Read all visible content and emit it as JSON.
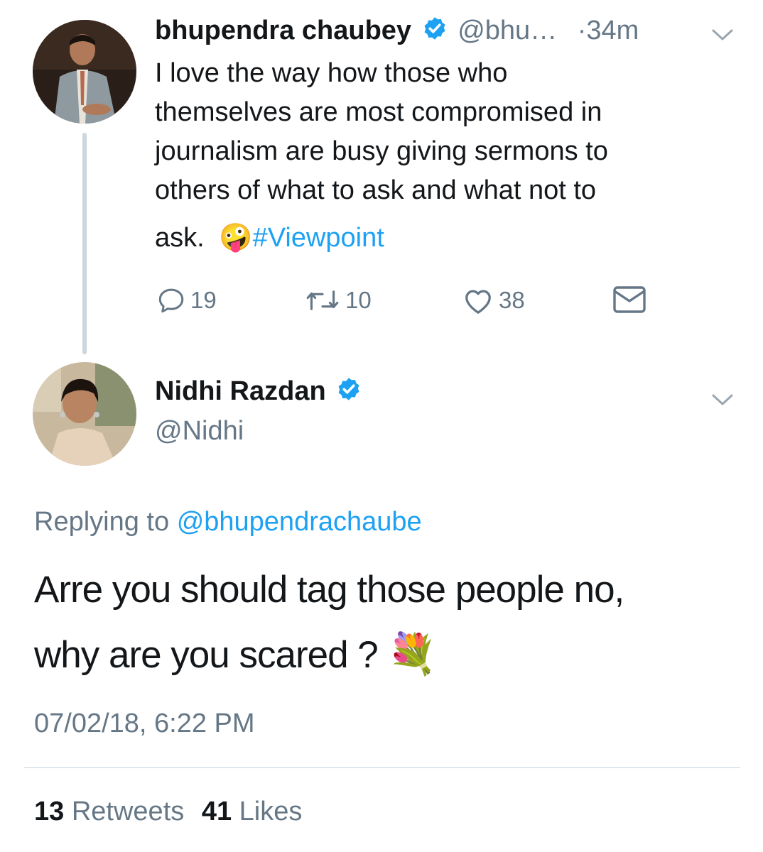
{
  "parent_tweet": {
    "author_name": "bhupendra chaubey",
    "handle": "@bhu…",
    "time": "·34m",
    "text_line1": "I love the way how those who",
    "text_line2": "themselves are most compromised in",
    "text_line3": "journalism are busy giving sermons to",
    "text_line4": "others of what to ask and what not to",
    "text_line5": "ask.",
    "hashtag": "#Viewpoint",
    "emoji": "🤪",
    "replies": "19",
    "retweets": "10",
    "likes": "38"
  },
  "main_tweet": {
    "author_name": "Nidhi Razdan",
    "handle": "@Nidhi",
    "replying_to_label": "Replying to",
    "replying_to_handle": "@bhupendrachaube",
    "text_line1": "Arre you should tag those people no,",
    "text_line2": "why are you scared ?",
    "emoji": "💐",
    "timestamp": "07/02/18, 6:22 PM",
    "retweet_count": "13",
    "retweet_label": "Retweets",
    "like_count": "41",
    "like_label": "Likes"
  },
  "colors": {
    "accent": "#1da1f2",
    "secondary_text": "#657786",
    "primary_text": "#14171a",
    "divider": "#e1e8ed"
  },
  "icons": [
    "verified-badge-icon",
    "chevron-down-icon",
    "reply-icon",
    "retweet-icon",
    "like-icon",
    "message-icon",
    "bouquet-emoji"
  ]
}
